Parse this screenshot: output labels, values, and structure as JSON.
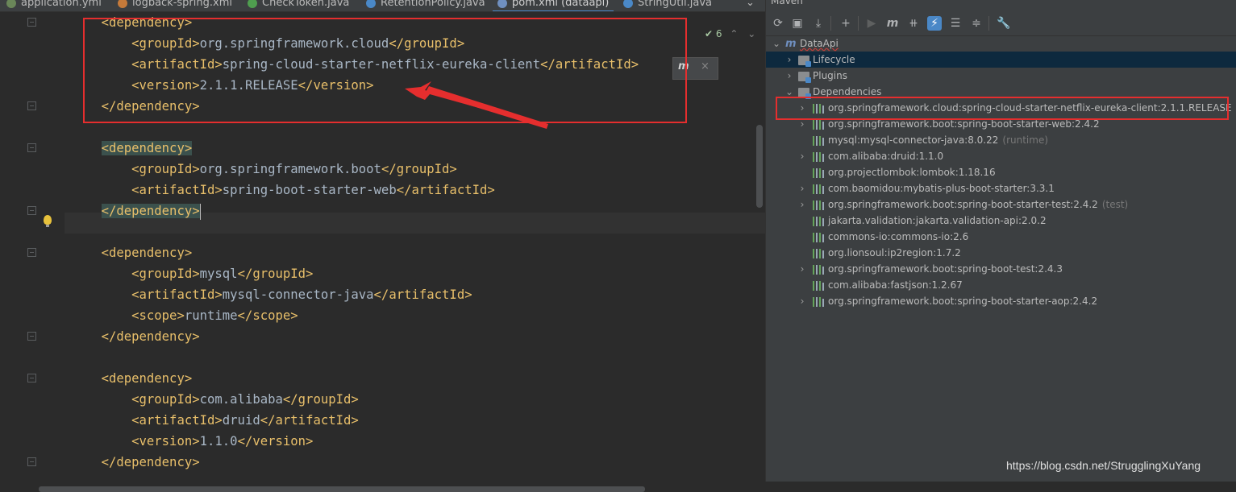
{
  "tabs": [
    {
      "label": "application.yml",
      "icon": "yaml-file-icon",
      "color": "#6a8759"
    },
    {
      "label": "logback-spring.xml",
      "icon": "xml-file-icon",
      "color": "#c57a3a"
    },
    {
      "label": "CheckToken.java",
      "icon": "class-file-icon",
      "color": "#4f9e4f"
    },
    {
      "label": "RetentionPolicy.java",
      "icon": "class-file-icon",
      "color": "#4a88c7"
    },
    {
      "label": "pom.xml (dataapi)",
      "icon": "maven-file-icon",
      "color": "#6f8fbf",
      "active": true
    },
    {
      "label": "StringUtil.java",
      "icon": "class-file-icon",
      "color": "#4a88c7"
    }
  ],
  "editor": {
    "inspection_count": "6",
    "lines": [
      {
        "indent": "    ",
        "open": "<dependency>",
        "text": "",
        "close": ""
      },
      {
        "indent": "        ",
        "open": "<groupId>",
        "text": "org.springframework.cloud",
        "close": "</groupId>"
      },
      {
        "indent": "        ",
        "open": "<artifactId>",
        "text": "spring-cloud-starter-netflix-eureka-client",
        "close": "</artifactId>"
      },
      {
        "indent": "        ",
        "open": "<version>",
        "text": "2.1.1.RELEASE",
        "close": "</version>"
      },
      {
        "indent": "    ",
        "open": "</dependency>",
        "text": "",
        "close": ""
      },
      {
        "indent": "",
        "open": "",
        "text": "",
        "close": ""
      },
      {
        "indent": "    ",
        "open": "<dependency>",
        "text": "",
        "close": "",
        "hl": true
      },
      {
        "indent": "        ",
        "open": "<groupId>",
        "text": "org.springframework.boot",
        "close": "</groupId>"
      },
      {
        "indent": "        ",
        "open": "<artifactId>",
        "text": "spring-boot-starter-web",
        "close": "</artifactId>"
      },
      {
        "indent": "    ",
        "open": "</dependency>",
        "text": "",
        "close": "",
        "hl": true,
        "caret": true
      },
      {
        "indent": "",
        "open": "",
        "text": "",
        "close": ""
      },
      {
        "indent": "    ",
        "open": "<dependency>",
        "text": "",
        "close": ""
      },
      {
        "indent": "        ",
        "open": "<groupId>",
        "text": "mysql",
        "close": "</groupId>"
      },
      {
        "indent": "        ",
        "open": "<artifactId>",
        "text": "mysql-connector-java",
        "close": "</artifactId>"
      },
      {
        "indent": "        ",
        "open": "<scope>",
        "text": "runtime",
        "close": "</scope>"
      },
      {
        "indent": "    ",
        "open": "</dependency>",
        "text": "",
        "close": ""
      },
      {
        "indent": "",
        "open": "",
        "text": "",
        "close": ""
      },
      {
        "indent": "    ",
        "open": "<dependency>",
        "text": "",
        "close": ""
      },
      {
        "indent": "        ",
        "open": "<groupId>",
        "text": "com.alibaba",
        "close": "</groupId>"
      },
      {
        "indent": "        ",
        "open": "<artifactId>",
        "text": "druid",
        "close": "</artifactId>"
      },
      {
        "indent": "        ",
        "open": "<version>",
        "text": "1.1.0",
        "close": "</version>"
      },
      {
        "indent": "    ",
        "open": "</dependency>",
        "text": "",
        "close": ""
      }
    ]
  },
  "maven": {
    "title": "Maven",
    "project": "DataApi",
    "sections": [
      "Lifecycle",
      "Plugins",
      "Dependencies"
    ],
    "dependencies": [
      {
        "name": "org.springframework.cloud:spring-cloud-starter-netflix-eureka-client:2.1.1.RELEASE",
        "scope": "",
        "expandable": true
      },
      {
        "name": "org.springframework.boot:spring-boot-starter-web:2.4.2",
        "scope": "",
        "expandable": true
      },
      {
        "name": "mysql:mysql-connector-java:8.0.22",
        "scope": "(runtime)",
        "expandable": false
      },
      {
        "name": "com.alibaba:druid:1.1.0",
        "scope": "",
        "expandable": true
      },
      {
        "name": "org.projectlombok:lombok:1.18.16",
        "scope": "",
        "expandable": false
      },
      {
        "name": "com.baomidou:mybatis-plus-boot-starter:3.3.1",
        "scope": "",
        "expandable": true
      },
      {
        "name": "org.springframework.boot:spring-boot-starter-test:2.4.2",
        "scope": "(test)",
        "expandable": true
      },
      {
        "name": "jakarta.validation:jakarta.validation-api:2.0.2",
        "scope": "",
        "expandable": false
      },
      {
        "name": "commons-io:commons-io:2.6",
        "scope": "",
        "expandable": false
      },
      {
        "name": "org.lionsoul:ip2region:1.7.2",
        "scope": "",
        "expandable": false
      },
      {
        "name": "org.springframework.boot:spring-boot-test:2.4.3",
        "scope": "",
        "expandable": true
      },
      {
        "name": "com.alibaba:fastjson:1.2.67",
        "scope": "",
        "expandable": false
      },
      {
        "name": "org.springframework.boot:spring-boot-starter-aop:2.4.2",
        "scope": "",
        "expandable": true
      }
    ]
  },
  "watermark": "https://blog.csdn.net/StrugglingXuYang",
  "colors": {
    "annotation": "#e52e2e",
    "accent": "#4a88c7",
    "tag": "#e8bf6a"
  }
}
